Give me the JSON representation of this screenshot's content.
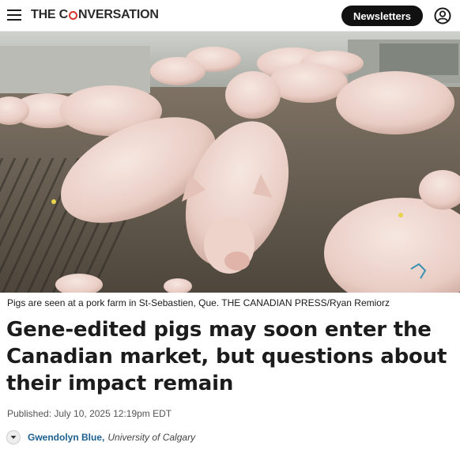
{
  "header": {
    "brand_pre": "THE C",
    "brand_post": "NVERSATION",
    "newsletters_label": "Newsletters",
    "icons": {
      "menu": "hamburger-menu-icon",
      "account": "user-account-icon"
    },
    "colors": {
      "brand_accent": "#d8352a",
      "button_bg": "#111111"
    }
  },
  "hero": {
    "caption": "Pigs are seen at a pork farm in St-Sebastien, Que. THE CANADIAN PRESS/Ryan Remiorz"
  },
  "article": {
    "headline": "Gene-edited pigs may soon enter the Canadian market, but questions about their impact remain",
    "published": "Published: July 10, 2025 12:19pm EDT",
    "author": {
      "name": "Gwendolyn Blue",
      "separator": ",",
      "affiliation": "University of Calgary"
    },
    "colors": {
      "author_link": "#1b5f8f"
    }
  }
}
